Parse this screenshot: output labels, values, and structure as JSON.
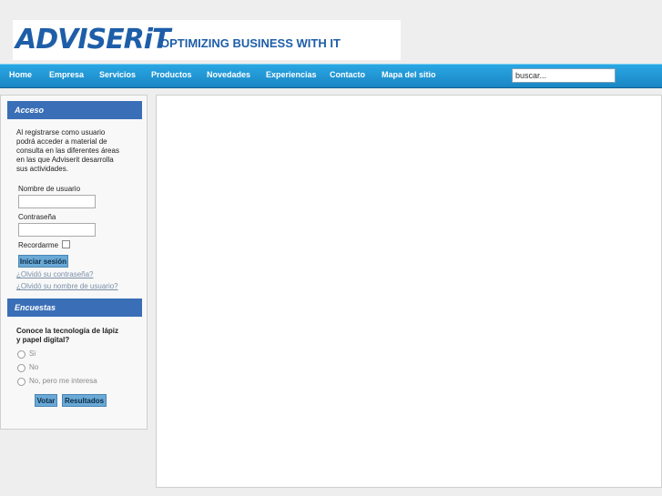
{
  "header": {
    "logo_name": "ADVISERiT",
    "logo_tagline": "OPTIMIZING BUSINESS WITH IT"
  },
  "nav": {
    "items": [
      "Home",
      "Empresa",
      "Servicios",
      "Productos",
      "Novedades",
      "Experiencias",
      "Contacto",
      "Mapa del sitio"
    ],
    "search_value": "buscar..."
  },
  "login": {
    "title": "Acceso",
    "intro_lines": [
      "Al registrarse como usuario",
      "podrá acceder a material de",
      "consulta en las diferentes áreas",
      "en las que Adviserit desarrolla",
      "sus actividades."
    ],
    "username_label": "Nombre de usuario",
    "password_label": "Contraseña",
    "remember_label": "Recordarme",
    "submit_label": "Iniciar sesión",
    "forgot_password": "¿Olvidó su contraseña?",
    "forgot_username": "¿Olvidó su nombre de usuario?"
  },
  "poll": {
    "title": "Encuestas",
    "question_lines": [
      "Conoce la tecnología de lápiz",
      "y papel digital?"
    ],
    "options": [
      "Si",
      "No",
      "No, pero me interesa"
    ],
    "vote_label": "Votar",
    "results_label": "Resultados"
  },
  "colors": {
    "nav_bar": "#1a86c4",
    "module_header": "#3a6fb7",
    "button": "#6aa9d6",
    "logo_blue": "#1e5ea8"
  }
}
